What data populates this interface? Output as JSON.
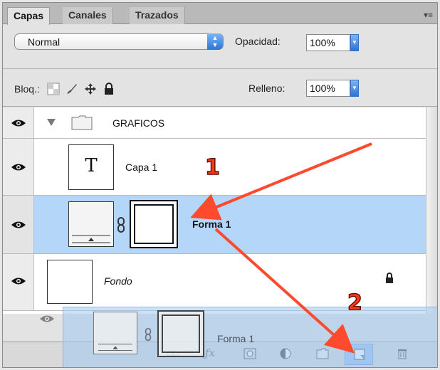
{
  "tabs": [
    {
      "label": "Capas",
      "active": true
    },
    {
      "label": "Canales",
      "active": false
    },
    {
      "label": "Trazados",
      "active": false
    }
  ],
  "blend": {
    "value": "Normal"
  },
  "opacity": {
    "label": "Opacidad:",
    "value": "100%"
  },
  "lock": {
    "label": "Bloq.:"
  },
  "fill": {
    "label": "Relleno:",
    "value": "100%"
  },
  "layers": [
    {
      "name": "GRAFICOS",
      "type": "group",
      "visible": true
    },
    {
      "name": "Capa 1",
      "type": "text",
      "thumb_glyph": "T",
      "visible": true
    },
    {
      "name": "Forma 1",
      "type": "shape",
      "visible": true,
      "selected": true
    },
    {
      "name": "Fondo",
      "type": "background",
      "visible": true,
      "locked": true
    }
  ],
  "drag_ghost": {
    "name": "Forma 1"
  },
  "annotations": {
    "badge1": "1",
    "badge2": "2",
    "color": "#ff4a2e"
  },
  "colors": {
    "selection": "#b4d6f9",
    "accent": "#2d73d6"
  }
}
